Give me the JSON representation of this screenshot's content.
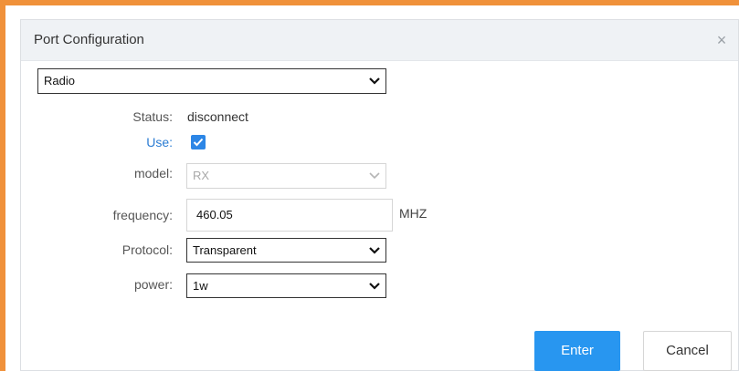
{
  "dialog": {
    "title": "Port Configuration",
    "close_symbol": "×",
    "close_icon": "close-icon"
  },
  "port_select": {
    "value": "Radio"
  },
  "fields": {
    "status": {
      "label": "Status:",
      "value": "disconnect"
    },
    "use": {
      "label": "Use:",
      "checked": true
    },
    "model": {
      "label": "model:",
      "value": "RX",
      "disabled": true
    },
    "frequency": {
      "label": "frequency:",
      "value": "460.05",
      "unit": "MHZ"
    },
    "protocol": {
      "label": "Protocol:",
      "value": "Transparent"
    },
    "power": {
      "label": "power:",
      "value": "1w"
    }
  },
  "buttons": {
    "enter": "Enter",
    "cancel": "Cancel"
  },
  "colors": {
    "accent": "#2896f0",
    "frame": "#f0913a",
    "label_highlight": "#2b7cd3"
  }
}
